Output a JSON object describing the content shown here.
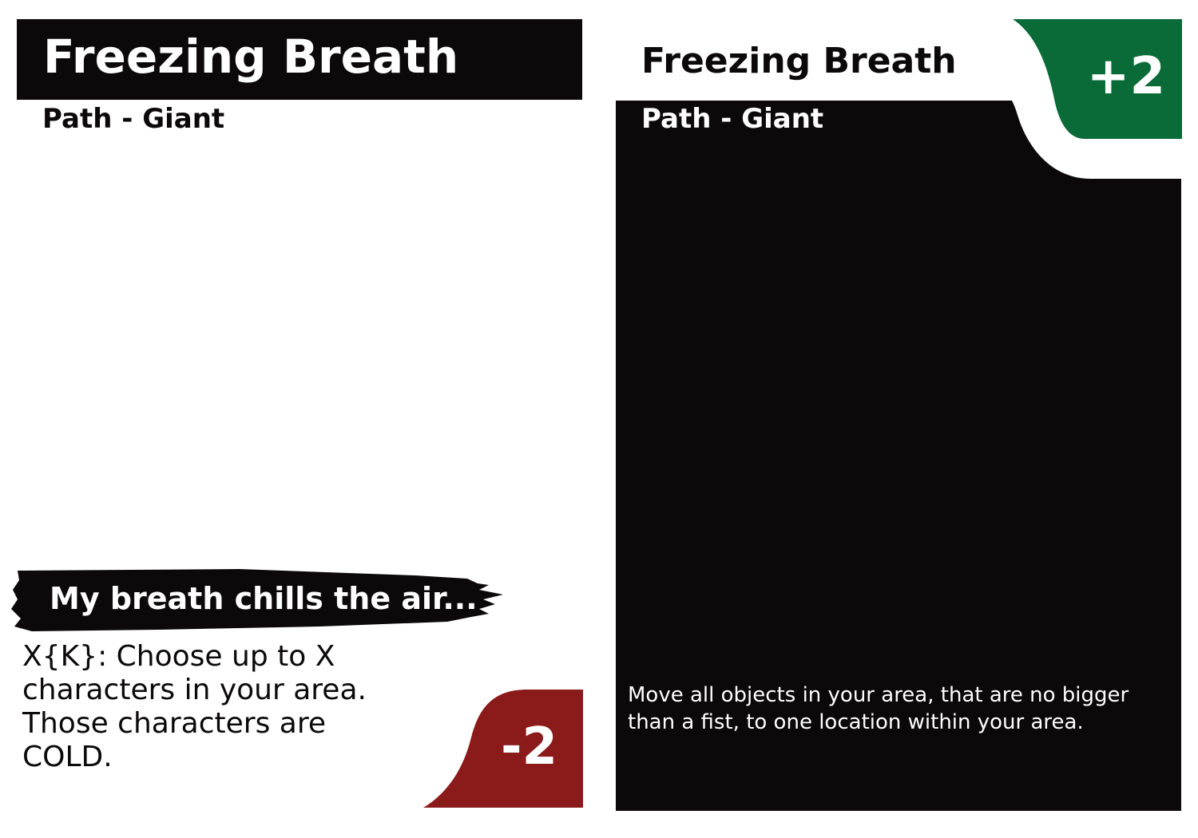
{
  "left_card": {
    "title": "Freezing Breath",
    "subtitle": "Path - Giant",
    "flavor": "My breath chills the air...",
    "rules": "X{K}: Choose up to X characters in your area. Those characters are COLD.",
    "cost": "-2",
    "cost_color": "#8b1a1a"
  },
  "right_card": {
    "title": "Freezing Breath",
    "subtitle": "Path - Giant",
    "bonus": "+2",
    "bonus_color": "#0a6b38",
    "rules": "Move all objects in your area, that are no bigger than a fist, to one location within your area."
  }
}
